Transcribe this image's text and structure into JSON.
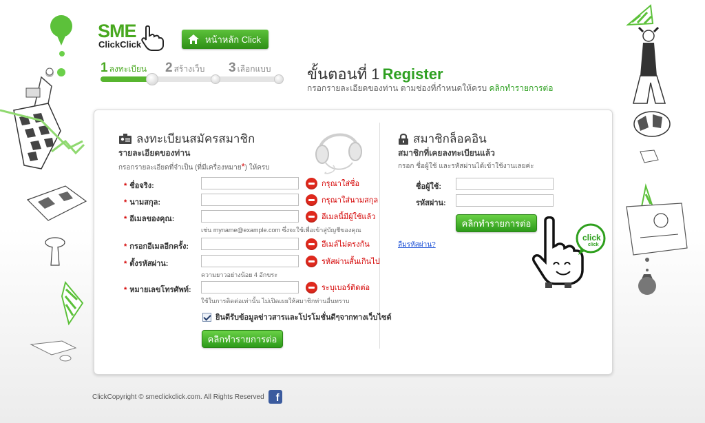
{
  "logo": {
    "line1": "SME",
    "line2": "ClickClick"
  },
  "home_button": {
    "label": "หน้าหลัก Click"
  },
  "steps": [
    {
      "num": "1",
      "label": "ลงทะเบียน"
    },
    {
      "num": "2",
      "label": "สร้างเว็บ"
    },
    {
      "num": "3",
      "label": "เลือกแบบ"
    }
  ],
  "page_title": {
    "prefix": "ขั้นตอนที่ 1",
    "highlight": "Register"
  },
  "page_subtitle": {
    "text": "กรอกรายละเอียดของท่าน ตามช่องที่กำหนดให้ครบ",
    "link": "คลิกทำรายการต่อ"
  },
  "register": {
    "title": "ลงทะเบียนสมัครสมาชิก",
    "subtitle": "รายละเอียดของท่าน",
    "note_prefix": "กรอกรายละเอียดที่จำเป็น (ที่มีเครื่องหมาย",
    "note_star": "*",
    "note_suffix": ") ให้ครบ",
    "fields": [
      {
        "label": "ชื่อจริง:",
        "value": "",
        "error": "กรุณาใส่ชื่อ",
        "hint": ""
      },
      {
        "label": "นามสกุล:",
        "value": "",
        "error": "กรุณาใส่นามสกุล",
        "hint": ""
      },
      {
        "label": "อีเมลของคุณ:",
        "value": "",
        "error": "อีเมลนี้มีผู้ใช้แล้ว",
        "hint": "เช่น myname@example.com ซึ่งจะใช้เพื่อเข้าสู่บัญชีของคุณ"
      },
      {
        "label": "กรอกอีเมลอีกครั้ง:",
        "value": "",
        "error": "อีเมล์ไม่ตรงกัน",
        "hint": ""
      },
      {
        "label": "ตั้งรหัสผ่าน:",
        "value": "",
        "error": "รหัสผ่านสั้นเกินไป",
        "hint": "ความยาวอย่างน้อย 4 อักขระ"
      },
      {
        "label": "หมายเลขโทรศัพท์:",
        "value": "",
        "error": "ระบุเบอร์ติดต่อ",
        "hint": "ใช้ในการติดต่อเท่านั้น ไม่เปิดเผยให้สมาชิกท่านอื่นทราบ"
      }
    ],
    "required_star": "*",
    "checkbox_label": "ยินดีรับข้อมูลข่าวสารและโปรโมชั่นดีๆจากทางเว็บไซต์",
    "checkbox_checked": true,
    "submit_label": "คลิกทำรายการต่อ"
  },
  "login": {
    "title": "สมาชิกล็อคอิน",
    "subtitle": "สมาชิกที่เคยลงทะเบียนแล้ว",
    "note": "กรอก ชื่อผู้ใช้ และรหัสผ่านได้เข้าใช้งานเลยค่ะ",
    "username_label": "ชื่อผู้ใช้:",
    "username_value": "",
    "password_label": "รหัสผ่าน:",
    "password_value": "",
    "submit_label": "คลิกทำรายการต่อ",
    "forgot_label": "ลืมรหัสผ่าน?",
    "bubble_text": "click",
    "bubble_small": "click"
  },
  "footer": {
    "text": "ClickCopyright © smeclickclick.com. All Rights Reserved",
    "fb_icon": "f"
  },
  "colors": {
    "accent": "#48a81f",
    "error": "#d40000",
    "link": "#1a4fd6"
  }
}
